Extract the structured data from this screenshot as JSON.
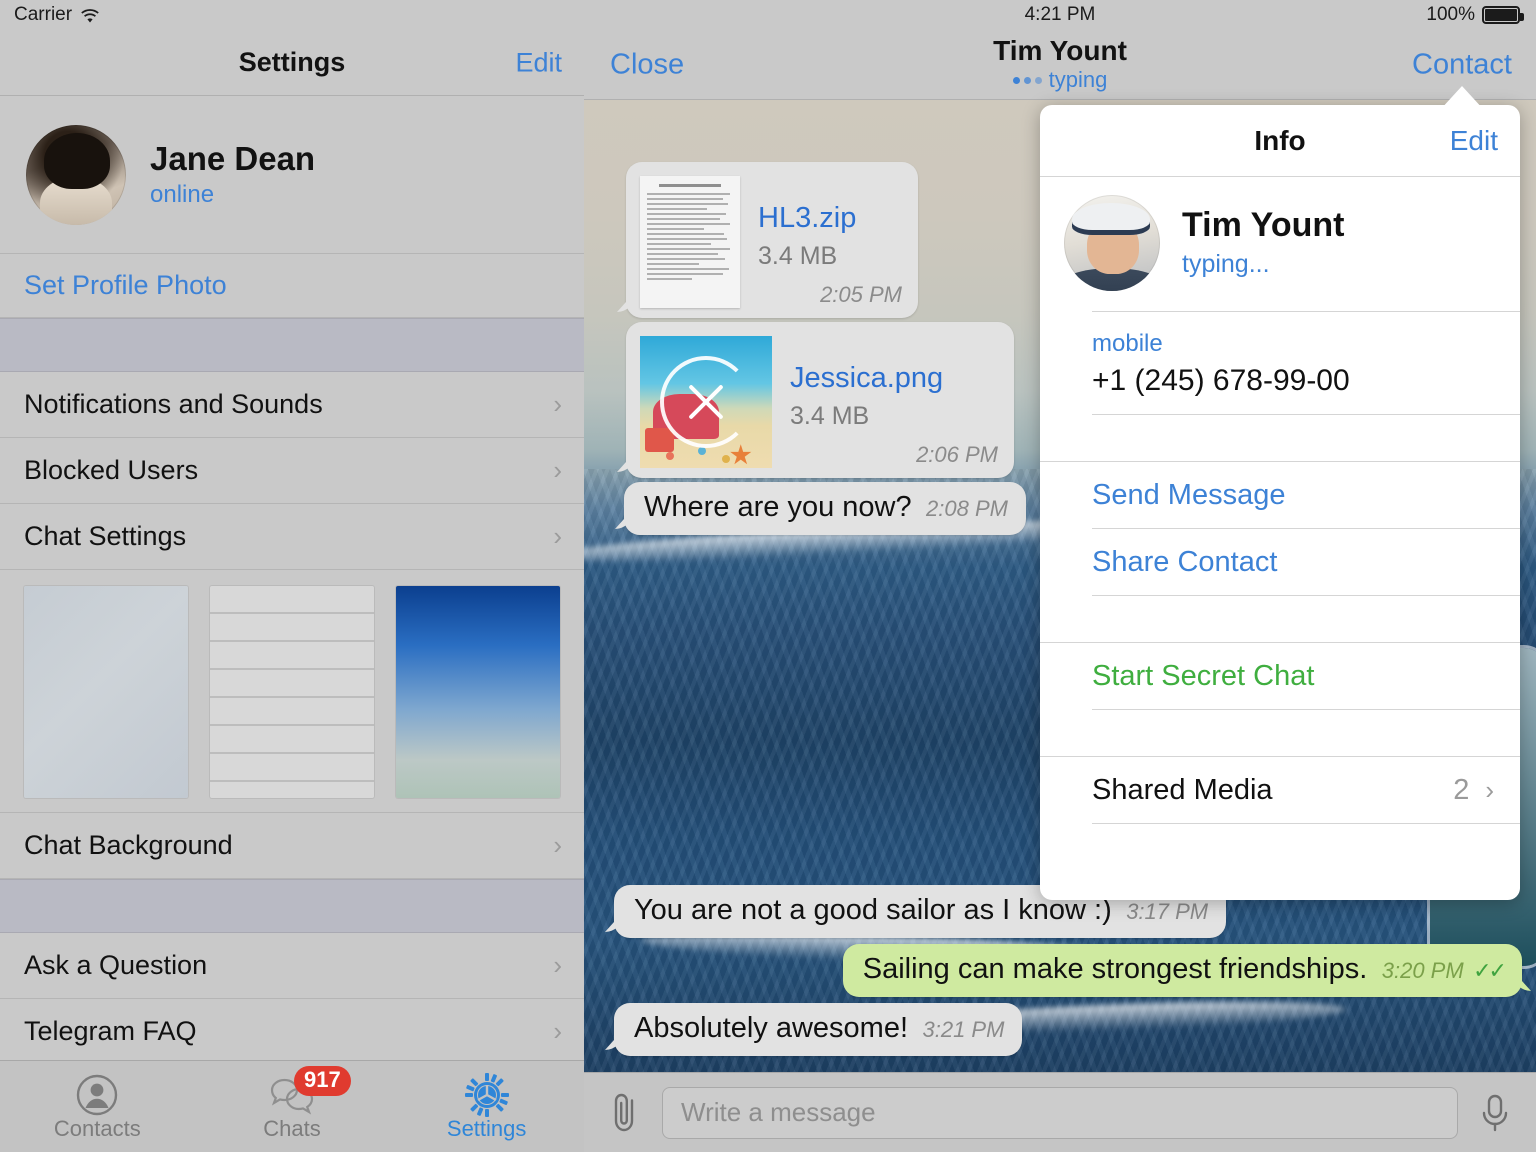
{
  "left_pane": {
    "status_bar": {
      "carrier": "Carrier",
      "wifi_icon": "wifi-icon"
    },
    "navbar": {
      "title": "Settings",
      "edit_label": "Edit"
    },
    "profile": {
      "name": "Jane Dean",
      "status": "online",
      "avatar_icon": "user-avatar"
    },
    "set_profile_photo_label": "Set Profile Photo",
    "menu_group_1": [
      {
        "label": "Notifications and Sounds"
      },
      {
        "label": "Blocked Users"
      },
      {
        "label": "Chat Settings"
      }
    ],
    "wallpapers": [
      {
        "name": "plain-gray-wallpaper"
      },
      {
        "name": "wood-planks-wallpaper"
      },
      {
        "name": "blue-sky-wallpaper"
      }
    ],
    "chat_background_label": "Chat Background",
    "menu_group_2": [
      {
        "label": "Ask a Question"
      },
      {
        "label": "Telegram FAQ"
      }
    ],
    "tabs": [
      {
        "label": "Contacts",
        "icon": "contacts-icon",
        "active": false,
        "badge": ""
      },
      {
        "label": "Chats",
        "icon": "chats-icon",
        "active": false,
        "badge": "917"
      },
      {
        "label": "Settings",
        "icon": "gear-icon",
        "active": true,
        "badge": ""
      }
    ]
  },
  "right_pane": {
    "status_bar": {
      "time": "4:21 PM",
      "battery_percent": "100%",
      "battery_icon": "battery-full-icon"
    },
    "navbar": {
      "close_label": "Close",
      "title": "Tim Yount",
      "typing_label": "typing",
      "contact_label": "Contact"
    },
    "messages": [
      {
        "kind": "file",
        "direction": "incoming",
        "filename": "HL3.zip",
        "filesize": "3.4 MB",
        "time": "2:05 PM",
        "thumb": "document-thumbnail"
      },
      {
        "kind": "file",
        "direction": "incoming",
        "filename": "Jessica.png",
        "filesize": "3.4 MB",
        "time": "2:06 PM",
        "thumb": "image-thumbnail",
        "cancel_icon": "cancel-download-icon"
      },
      {
        "kind": "text",
        "direction": "incoming",
        "text": "Where are you now?",
        "time": "2:08 PM"
      },
      {
        "kind": "text",
        "direction": "incoming",
        "text": "You are not a good sailor as I know :)",
        "time": "3:17 PM"
      },
      {
        "kind": "text",
        "direction": "outgoing",
        "text": "Sailing can make strongest friendships.",
        "time": "3:20 PM",
        "read_receipt": "✓✓"
      },
      {
        "kind": "text",
        "direction": "incoming",
        "text": "Absolutely awesome!",
        "time": "3:21 PM"
      }
    ],
    "input_bar": {
      "attach_icon": "paperclip-icon",
      "placeholder": "Write a message",
      "value": "",
      "mic_icon": "microphone-icon"
    }
  },
  "popover": {
    "navbar": {
      "title": "Info",
      "edit_label": "Edit"
    },
    "person": {
      "name": "Tim Yount",
      "status": "typing...",
      "avatar_icon": "contact-avatar"
    },
    "phone": {
      "label": "mobile",
      "number": "+1 (245) 678-99-00"
    },
    "actions": [
      {
        "label": "Send Message",
        "style": "blue"
      },
      {
        "label": "Share Contact",
        "style": "blue"
      },
      {
        "label": "Start Secret Chat",
        "style": "green"
      }
    ],
    "shared_media": {
      "label": "Shared Media",
      "count": "2"
    }
  },
  "colors": {
    "accent_blue": "#3d82d6",
    "secret_green": "#3fae3f",
    "badge_red": "#e03b2f",
    "outgoing_bubble": "#cfeaa0",
    "incoming_bubble": "#e2e2e2"
  }
}
